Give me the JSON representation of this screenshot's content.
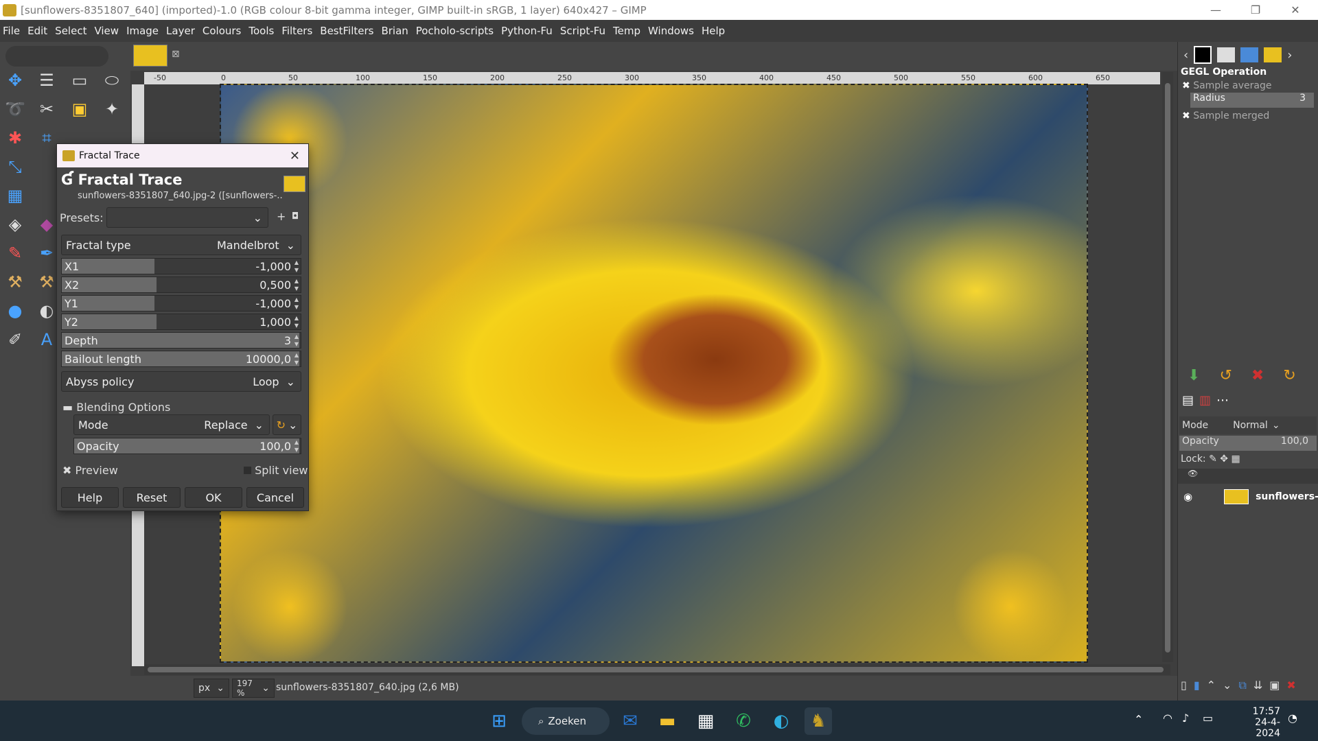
{
  "window": {
    "title": "[sunflowers-8351807_640] (imported)-1.0 (RGB colour 8-bit gamma integer, GIMP built-in sRGB, 1 layer) 640x427 – GIMP"
  },
  "menu": [
    "File",
    "Edit",
    "Select",
    "View",
    "Image",
    "Layer",
    "Colours",
    "Tools",
    "Filters",
    "BestFilters",
    "Brian",
    "Pocholo-scripts",
    "Python-Fu",
    "Script-Fu",
    "Temp",
    "Windows",
    "Help"
  ],
  "ruler": {
    "labels": [
      "-50",
      "0",
      "50",
      "100",
      "150",
      "200",
      "250",
      "300",
      "350",
      "400",
      "450",
      "500",
      "550",
      "600",
      "650"
    ]
  },
  "status": {
    "unit": "px",
    "zoom": "197 %",
    "file_info": "sunflowers-8351807_640.jpg (2,6 MB)"
  },
  "right_panel": {
    "title": "GEGL Operation",
    "sample_average": "Sample average",
    "radius_label": "Radius",
    "radius_value": "3",
    "sample_merged": "Sample merged",
    "mode_label": "Mode",
    "mode_value": "Normal",
    "opacity_label": "Opacity",
    "opacity_value": "100,0",
    "lock_label": "Lock:",
    "layer_name": "sunflowers-"
  },
  "dialog": {
    "window_title": "Fractal Trace",
    "heading": "Fractal Trace",
    "subtitle": "sunflowers-8351807_640.jpg-2 ([sunflowers-...",
    "presets_label": "Presets:",
    "fractal_type_label": "Fractal type",
    "fractal_type_value": "Mandelbrot",
    "x1": {
      "label": "X1",
      "value": "-1,000",
      "fraction": 0.39
    },
    "x2": {
      "label": "X2",
      "value": "0,500",
      "fraction": 0.4
    },
    "y1": {
      "label": "Y1",
      "value": "-1,000",
      "fraction": 0.39
    },
    "y2": {
      "label": "Y2",
      "value": "1,000",
      "fraction": 0.4
    },
    "depth": {
      "label": "Depth",
      "value": "3",
      "fraction": 1.0
    },
    "bailout": {
      "label": "Bailout length",
      "value": "10000,0",
      "fraction": 1.0
    },
    "abyss_label": "Abyss policy",
    "abyss_value": "Loop",
    "blending_label": "Blending Options",
    "mode_label": "Mode",
    "mode_value": "Replace",
    "opacity": {
      "label": "Opacity",
      "value": "100,0",
      "fraction": 1.0
    },
    "preview_label": "Preview",
    "split_view_label": "Split view",
    "buttons": {
      "help": "Help",
      "reset": "Reset",
      "ok": "OK",
      "cancel": "Cancel"
    }
  },
  "taskbar": {
    "search_label": "Zoeken",
    "time": "17:57",
    "date": "24-4-2024"
  }
}
